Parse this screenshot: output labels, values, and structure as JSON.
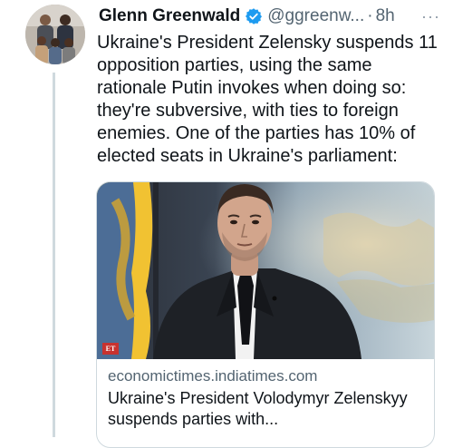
{
  "tweet": {
    "author_name": "Glenn Greenwald",
    "handle": "@ggreenw...",
    "separator": "·",
    "time": "8h",
    "more": "···",
    "text": "Ukraine's President Zelensky suspends 11 opposition parties, using the same rationale Putin invokes when doing so: they're subversive, with ties to foreign enemies. One of the parties has 10% of elected seats in Ukraine's parliament:"
  },
  "link_card": {
    "domain": "economictimes.indiatimes.com",
    "headline": "Ukraine's President Volodymyr Zelenskyy suspends parties with...",
    "badge": "ET"
  },
  "colors": {
    "verified": "#1d9bf0",
    "secondary_text": "#536471",
    "border": "#cfd9de"
  }
}
